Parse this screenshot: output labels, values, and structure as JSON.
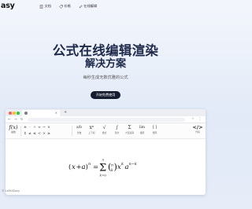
{
  "header": {
    "logo": "asy",
    "nav": [
      {
        "label": "文档",
        "icon": "doc-icon"
      },
      {
        "label": "价格",
        "icon": "price-tag-icon"
      },
      {
        "label": "在线编辑",
        "icon": "edit-icon"
      }
    ]
  },
  "hero": {
    "title_line1": "公式在线编辑渲染",
    "title_line2": "解决方案",
    "subtitle": "每秒生成无数优雅的公式",
    "cta": "开始免费使用"
  },
  "editor": {
    "tab_close": "×",
    "new_tab": "+",
    "nav_arrows": "← → ↻",
    "toolbar_right": "☆ ⋮",
    "fx_label": "函数",
    "symbols": [
      "±",
      "·",
      "÷",
      "≈",
      "~",
      "×",
      "↕",
      "≠",
      "≤",
      "<",
      ">",
      "≥"
    ],
    "tools": [
      {
        "glyph": "a/b",
        "label": "分数"
      },
      {
        "glyph": "xⁿ",
        "label": "上下标"
      },
      {
        "glyph": "√",
        "label": "根式"
      },
      {
        "glyph": "∫",
        "label": "积分"
      },
      {
        "glyph": "Σ",
        "label": "大型运算"
      },
      {
        "glyph": "lim",
        "label": "极限"
      },
      {
        "glyph": "[ ]",
        "label": "矩阵"
      }
    ],
    "code_label": "代码",
    "formula": "(x+a)^n = Σ_{k=0}^{n} (n choose k) x^k a^{n-k}"
  },
  "footer": {
    "credit": "© LaTeXEasy"
  }
}
